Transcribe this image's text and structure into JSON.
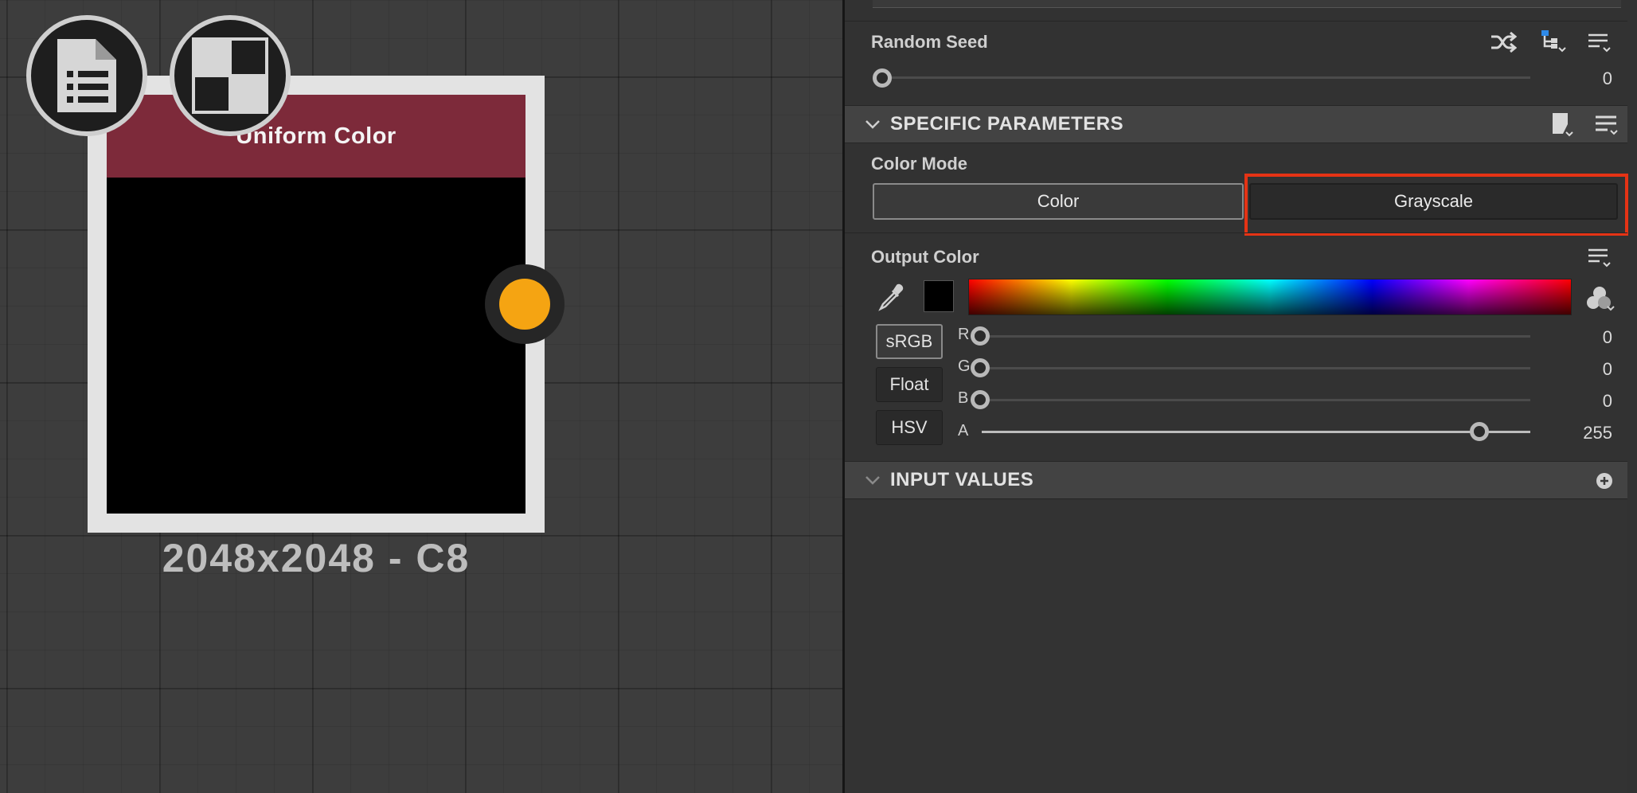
{
  "node": {
    "title": "Uniform Color",
    "caption": "2048x2048 - C8",
    "header_color": "#7d2a3a",
    "port_color": "#f5a412",
    "icons": [
      "document-list-icon",
      "checker-pattern-icon"
    ]
  },
  "random_seed": {
    "label": "Random Seed",
    "value": "0",
    "icons": [
      "shuffle-icon",
      "hierarchy-dropdown-icon",
      "menu-dropdown-icon"
    ]
  },
  "specific_parameters": {
    "title": "SPECIFIC PARAMETERS",
    "color_mode": {
      "label": "Color Mode",
      "options": [
        "Color",
        "Grayscale"
      ],
      "highlighted": "Grayscale"
    },
    "output_color": {
      "label": "Output Color",
      "swatch_color": "#000000",
      "format_buttons": [
        "sRGB",
        "Float",
        "HSV"
      ],
      "channels": [
        {
          "name": "R",
          "value": "0",
          "level": 0
        },
        {
          "name": "G",
          "value": "0",
          "level": 0
        },
        {
          "name": "B",
          "value": "0",
          "level": 0
        },
        {
          "name": "A",
          "value": "255",
          "level": 1
        }
      ]
    }
  },
  "input_values": {
    "title": "INPUT VALUES"
  },
  "colors": {
    "highlight_box": "#e53315",
    "panel_bg": "#323232"
  }
}
